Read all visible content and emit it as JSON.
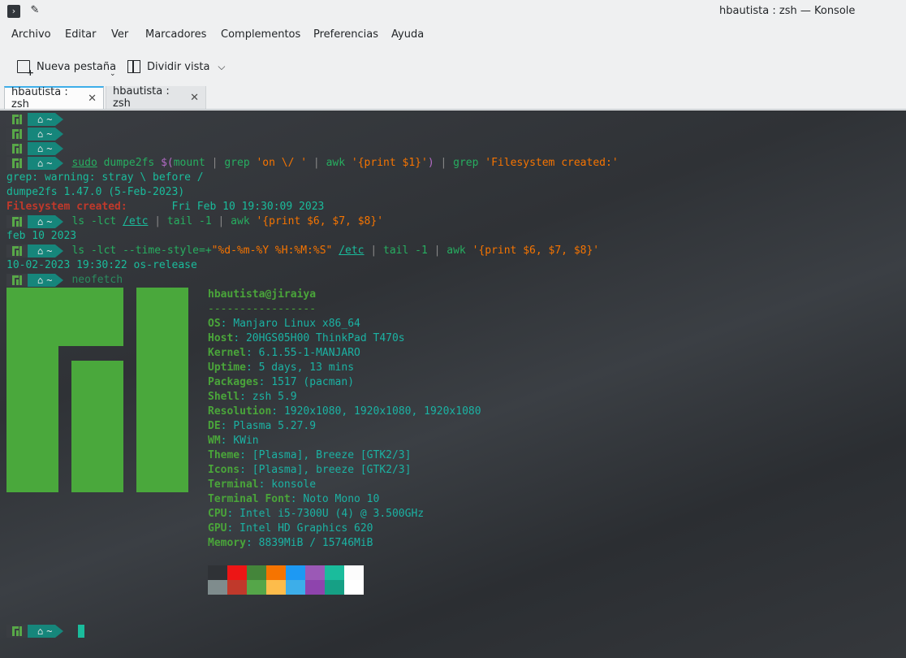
{
  "window": {
    "title": "hbautista : zsh — Konsole"
  },
  "icons": {
    "app": "terminal-app-icon",
    "pin": "pin-icon"
  },
  "menu": [
    "Archivo",
    "Editar",
    "Ver",
    "Marcadores",
    "Complementos",
    "Preferencias",
    "Ayuda"
  ],
  "toolbar": {
    "new_tab": "Nueva pestaña",
    "split_view": "Dividir vista"
  },
  "tabs": [
    {
      "label": "hbautista : zsh",
      "active": true
    },
    {
      "label": "hbautista : zsh",
      "active": false
    }
  ],
  "prompt": {
    "home_symbol": "~"
  },
  "terminal": {
    "cmd1": {
      "sudo": "sudo",
      "p1": " dumpe2fs ",
      "subst_open": "$(",
      "mount": "mount",
      "pipe1": " | ",
      "grep": "grep",
      "arg1": " 'on \\/ '",
      "pipe2": " | ",
      "awk": "awk",
      "arg2": " '{print $1}'",
      "subst_close": ")",
      "pipe3": " | ",
      "grep2": "grep",
      "arg3": " 'Filesystem created:'"
    },
    "out1": "grep: warning: stray \\ before /",
    "out2": "dumpe2fs 1.47.0 (5-Feb-2023)",
    "out3_label": "Filesystem created:",
    "out3_value": "       Fri Feb 10 19:30:09 2023",
    "cmd2": {
      "ls": "ls -lct ",
      "path": "/etc",
      "pipe1": " | ",
      "tail": "tail -1",
      "pipe2": " | ",
      "awk": "awk",
      "arg": " '{print $6, $7, $8}'"
    },
    "out4": "feb 10 2023",
    "cmd3": {
      "ls": "ls -lct --time-style=+",
      "fmt": "\"%d-%m-%Y %H:%M:%S\"",
      "space": " ",
      "path": "/etc",
      "pipe1": " | ",
      "tail": "tail -1",
      "pipe2": " | ",
      "awk": "awk",
      "arg": " '{print $6, $7, $8}'"
    },
    "out5": "10-02-2023 19:30:22 os-release",
    "cmd4": "neofetch"
  },
  "neofetch": {
    "user_host": "hbautista@jiraiya",
    "separator": "-----------------",
    "rows": [
      {
        "label": "OS",
        "value": "Manjaro Linux x86_64"
      },
      {
        "label": "Host",
        "value": "20HGS05H00 ThinkPad T470s"
      },
      {
        "label": "Kernel",
        "value": "6.1.55-1-MANJARO"
      },
      {
        "label": "Uptime",
        "value": "5 days, 13 mins"
      },
      {
        "label": "Packages",
        "value": "1517 (pacman)"
      },
      {
        "label": "Shell",
        "value": "zsh 5.9"
      },
      {
        "label": "Resolution",
        "value": "1920x1080, 1920x1080, 1920x1080"
      },
      {
        "label": "DE",
        "value": "Plasma 5.27.9"
      },
      {
        "label": "WM",
        "value": "KWin"
      },
      {
        "label": "Theme",
        "value": "[Plasma], Breeze [GTK2/3]"
      },
      {
        "label": "Icons",
        "value": "[Plasma], breeze [GTK2/3]"
      },
      {
        "label": "Terminal",
        "value": "konsole"
      },
      {
        "label": "Terminal Font",
        "value": "Noto Mono 10"
      },
      {
        "label": "CPU",
        "value": "Intel i5-7300U (4) @ 3.500GHz"
      },
      {
        "label": "GPU",
        "value": "Intel HD Graphics 620"
      },
      {
        "label": "Memory",
        "value": "8839MiB / 15746MiB"
      }
    ],
    "palette_top": [
      "#2f3236",
      "#ed1515",
      "#44853a",
      "#f67400",
      "#1d99f3",
      "#9b59b6",
      "#1abc9c",
      "#fcfcfc"
    ],
    "palette_bottom": [
      "#7f8c8d",
      "#c0392b",
      "#55a649",
      "#fdbc4b",
      "#3daee9",
      "#8e44ad",
      "#16a085",
      "#ffffff"
    ],
    "logo_color": "#4aa83c"
  }
}
